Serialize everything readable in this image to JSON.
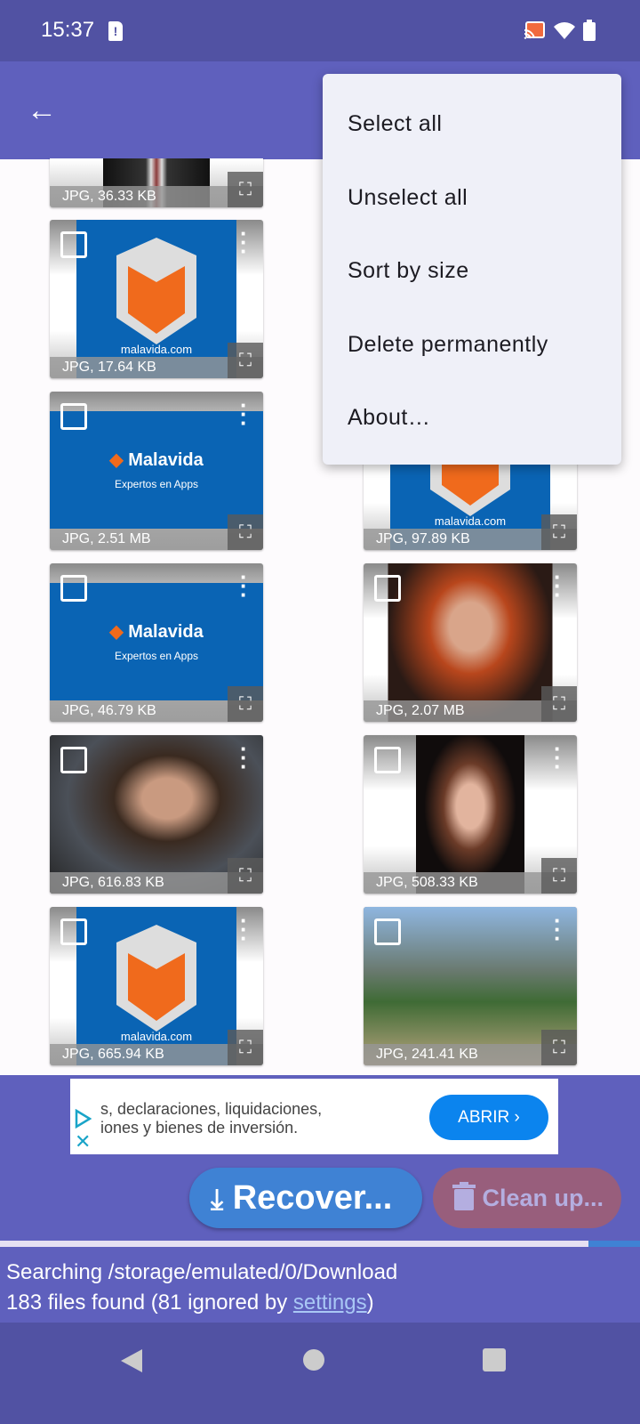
{
  "status_bar": {
    "time": "15:37"
  },
  "menu": {
    "items": [
      "Select all",
      "Unselect all",
      "Sort by size",
      "Delete permanently",
      "About…"
    ]
  },
  "files": [
    {
      "caption": "JPG, 36.33 KB",
      "thumb": "suit"
    },
    {
      "caption": "JPG, 17.64 KB",
      "thumb": "malavida-logo",
      "text": "malavida.com"
    },
    {
      "caption": "",
      "thumb": "hidden"
    },
    {
      "caption": "JPG, 2.51 MB",
      "thumb": "malavida-banner",
      "text": "Malavida",
      "sub": "Expertos en Apps"
    },
    {
      "caption": "JPG, 97.89 KB",
      "thumb": "malavida-logo",
      "text": "malavida.com"
    },
    {
      "caption": "JPG, 46.79 KB",
      "thumb": "malavida-banner",
      "text": "Malavida",
      "sub": "Expertos en Apps"
    },
    {
      "caption": "JPG, 2.07 MB",
      "thumb": "portrait-redhead"
    },
    {
      "caption": "JPG, 616.83 KB",
      "thumb": "portrait-bearded-man"
    },
    {
      "caption": "JPG, 508.33 KB",
      "thumb": "portrait-flower-crown"
    },
    {
      "caption": "JPG, 665.94 KB",
      "thumb": "malavida-logo",
      "text": "malavida.com"
    },
    {
      "caption": "JPG, 241.41 KB",
      "thumb": "game-scene"
    }
  ],
  "ad": {
    "line1": "s, declaraciones, liquidaciones,",
    "line2": "iones y bienes de inversión.",
    "button": "ABRIR ›"
  },
  "actions": {
    "recover": "Recover...",
    "clean": "Clean up..."
  },
  "progress": 0.92,
  "status": {
    "line1": "Searching /storage/emulated/0/Download",
    "line2_prefix": "183 files found (81 ignored by ",
    "link": "settings",
    "line2_suffix": ")"
  },
  "colors": {
    "primary": "#5f60bd",
    "status_bar": "#5152a3",
    "recover": "#3f82d4",
    "clean": "#985e7c"
  }
}
